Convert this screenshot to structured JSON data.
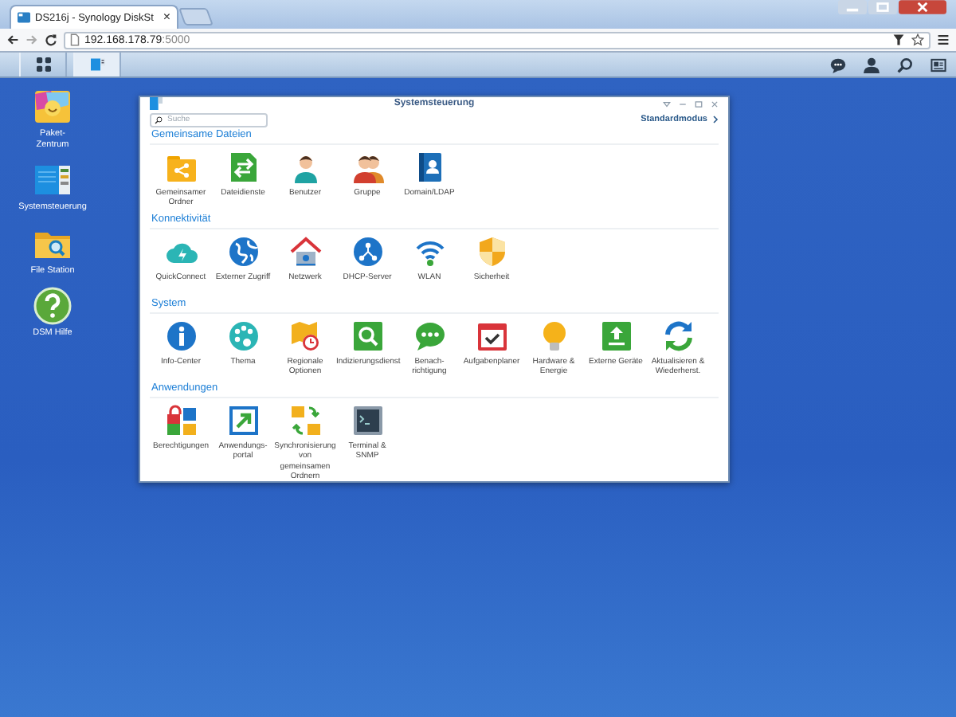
{
  "browser": {
    "tab_title": "DS216j - Synology DiskSt",
    "tab_close": "×",
    "address_host": "192.168.178.79",
    "address_port": ":5000"
  },
  "desktop_shortcuts": [
    {
      "label": "Paket-\nZentrum"
    },
    {
      "label": "Systemsteuerung"
    },
    {
      "label": "File Station"
    },
    {
      "label": "DSM Hilfe"
    }
  ],
  "window": {
    "title": "Systemsteuerung",
    "search": {
      "placeholder": "Suche"
    },
    "mode_link": "Standardmodus",
    "sections": [
      {
        "title": "Gemeinsame Dateien",
        "items": [
          {
            "label": "Gemeinsamer Ordner"
          },
          {
            "label": "Dateidienste"
          },
          {
            "label": "Benutzer"
          },
          {
            "label": "Gruppe"
          },
          {
            "label": "Domain/LDAP"
          }
        ]
      },
      {
        "title": "Konnektivität",
        "items": [
          {
            "label": "QuickConnect"
          },
          {
            "label": "Externer Zugriff"
          },
          {
            "label": "Netzwerk"
          },
          {
            "label": "DHCP-Server"
          },
          {
            "label": "WLAN"
          },
          {
            "label": "Sicherheit"
          }
        ]
      },
      {
        "title": "System",
        "items": [
          {
            "label": "Info-Center"
          },
          {
            "label": "Thema"
          },
          {
            "label": "Regionale Optionen"
          },
          {
            "label": "Indizierungsdienst"
          },
          {
            "label": "Benach-\nrichtigung"
          },
          {
            "label": "Aufgabenplaner"
          },
          {
            "label": "Hardware & Energie"
          },
          {
            "label": "Externe Geräte"
          },
          {
            "label": "Aktualisieren & Wiederherst."
          }
        ]
      },
      {
        "title": "Anwendungen",
        "items": [
          {
            "label": "Berechtigungen"
          },
          {
            "label": "Anwendungs-\nportal"
          },
          {
            "label": "Synchronisierung von gemeinsamen Ordnern"
          },
          {
            "label": "Terminal & SNMP"
          }
        ]
      }
    ]
  }
}
